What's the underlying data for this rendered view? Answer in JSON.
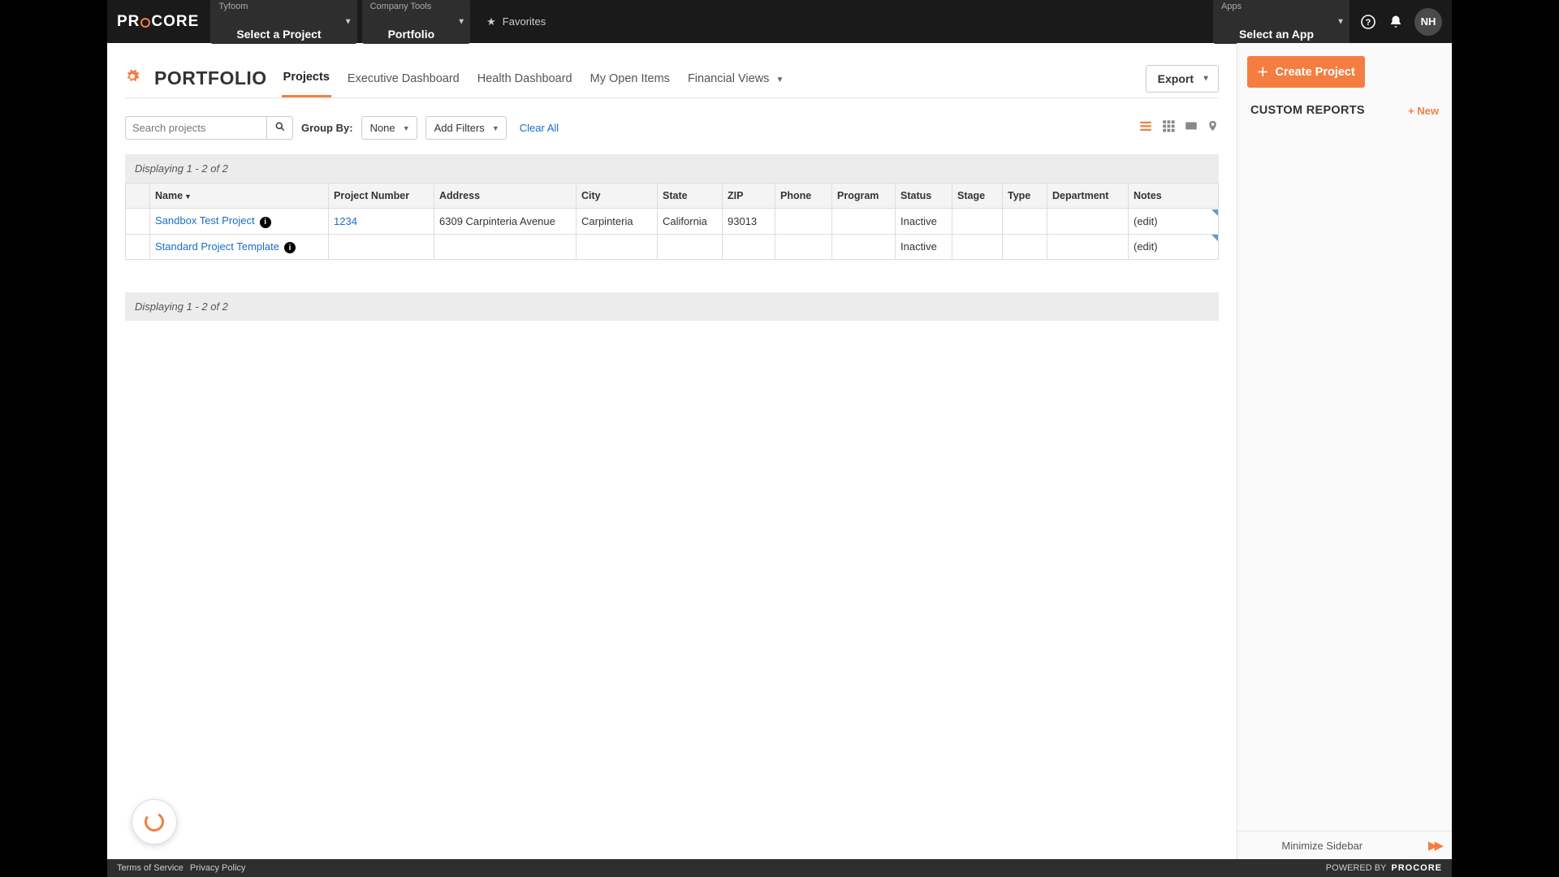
{
  "header": {
    "brand": "PROCORE",
    "project_sel": {
      "sup": "Tyfoom",
      "main": "Select a Project"
    },
    "tools_sel": {
      "sup": "Company Tools",
      "main": "Portfolio"
    },
    "favorites": "Favorites",
    "apps_sel": {
      "sup": "Apps",
      "main": "Select an App"
    },
    "avatar": "NH"
  },
  "page": {
    "title": "PORTFOLIO",
    "tabs": [
      "Projects",
      "Executive Dashboard",
      "Health Dashboard",
      "My Open Items",
      "Financial Views"
    ],
    "active_tab": 0,
    "export": "Export"
  },
  "filters": {
    "search_placeholder": "Search projects",
    "groupby_label": "Group By:",
    "groupby_value": "None",
    "addfilters": "Add Filters",
    "clear": "Clear All"
  },
  "displaying": "Displaying 1 - 2 of 2",
  "columns": [
    "",
    "Name",
    "Project Number",
    "Address",
    "City",
    "State",
    "ZIP",
    "Phone",
    "Program",
    "Status",
    "Stage",
    "Type",
    "Department",
    "Notes"
  ],
  "rows": [
    {
      "name": "Sandbox Test Project",
      "info": true,
      "number": "1234",
      "address": "6309 Carpinteria Avenue",
      "city": "Carpinteria",
      "state": "California",
      "zip": "93013",
      "phone": "",
      "program": "",
      "status": "Inactive",
      "stage": "",
      "type": "",
      "department": "",
      "notes": "(edit)"
    },
    {
      "name": "Standard Project Template",
      "info": true,
      "number": "",
      "address": "",
      "city": "",
      "state": "",
      "zip": "",
      "phone": "",
      "program": "",
      "status": "Inactive",
      "stage": "",
      "type": "",
      "department": "",
      "notes": "(edit)"
    }
  ],
  "sidebar": {
    "create": "Create Project",
    "reports_title": "CUSTOM REPORTS",
    "new": "+ New",
    "minimize": "Minimize Sidebar"
  },
  "footer": {
    "tos": "Terms of Service",
    "privacy": "Privacy Policy",
    "powered": "POWERED BY"
  }
}
